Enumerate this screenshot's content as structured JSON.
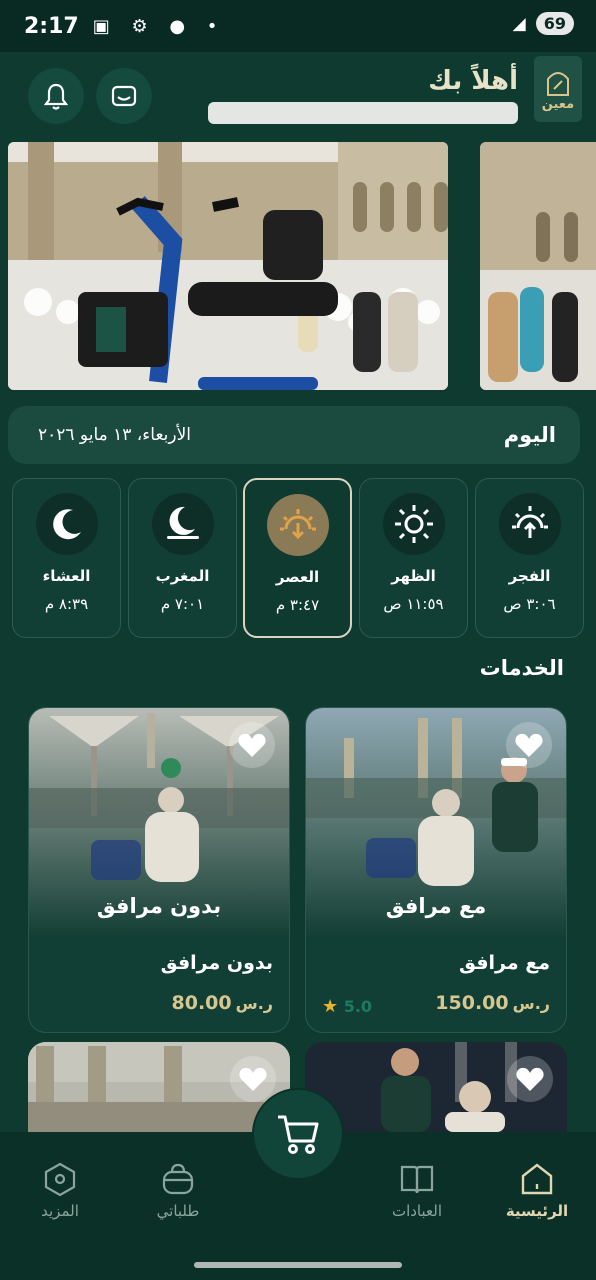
{
  "status_bar": {
    "time": "2:17",
    "battery": "69"
  },
  "header": {
    "greeting": "أهلاً بك",
    "logo_text": "معين"
  },
  "today": {
    "label": "اليوم",
    "date": "الأربعاء، ١٣ مايو ٢٠٢٦"
  },
  "prayers": [
    {
      "name": "الفجر",
      "time": "٣:٠٦ ص",
      "icon": "sunrise-icon",
      "active": false
    },
    {
      "name": "الظهر",
      "time": "١١:٥٩ ص",
      "icon": "sun-icon",
      "active": false
    },
    {
      "name": "العصر",
      "time": "٣:٤٧ م",
      "icon": "sunset-icon",
      "active": true
    },
    {
      "name": "المغرب",
      "time": "٧:٠١ م",
      "icon": "moon-horizon-icon",
      "active": false
    },
    {
      "name": "العشاء",
      "time": "٨:٣٩ م",
      "icon": "moon-icon",
      "active": false
    }
  ],
  "services": {
    "title": "الخدمات",
    "items": [
      {
        "overlay_title": "مع مرافق",
        "name": "مع مرافق",
        "price": "150.00",
        "currency": "ر.س",
        "rating": "5.0"
      },
      {
        "overlay_title": "بدون مرافق",
        "name": "بدون مرافق",
        "price": "80.00",
        "currency": "ر.س"
      }
    ]
  },
  "nav": {
    "home": "الرئيسية",
    "worship": "العبادات",
    "orders": "طلباتي",
    "more": "المزيد"
  },
  "colors": {
    "background": "#0f3a30",
    "accent": "#d6c790",
    "card": "#123f35"
  }
}
